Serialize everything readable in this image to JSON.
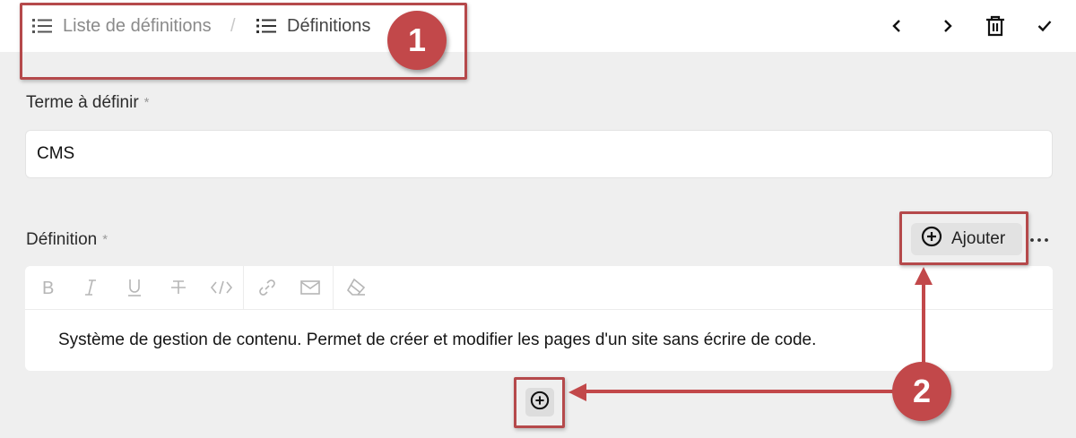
{
  "breadcrumb": {
    "items": [
      {
        "label": "Liste de définitions",
        "icon": "list-icon"
      },
      {
        "label": "Définitions",
        "icon": "list-icon"
      }
    ],
    "separator": "/"
  },
  "toolbar": {
    "actions": [
      "chevron-left-icon",
      "chevron-right-icon",
      "trash-icon",
      "check-icon"
    ]
  },
  "form": {
    "term": {
      "label": "Terme à définir",
      "required_mark": "*",
      "value": "CMS"
    },
    "definition": {
      "label": "Définition",
      "required_mark": "*",
      "add_button_label": "Ajouter",
      "more_label": "···",
      "editor_toolbar": [
        "bold-icon",
        "italic-icon",
        "underline-icon",
        "strikethrough-icon",
        "code-icon",
        "link-icon",
        "email-icon",
        "clear-format-icon"
      ],
      "content": "Système de gestion de contenu. Permet de créer et modifier les pages d'un site sans écrire de code."
    }
  },
  "annotations": {
    "badge1": "1",
    "badge2": "2",
    "color": "#c2484a"
  }
}
